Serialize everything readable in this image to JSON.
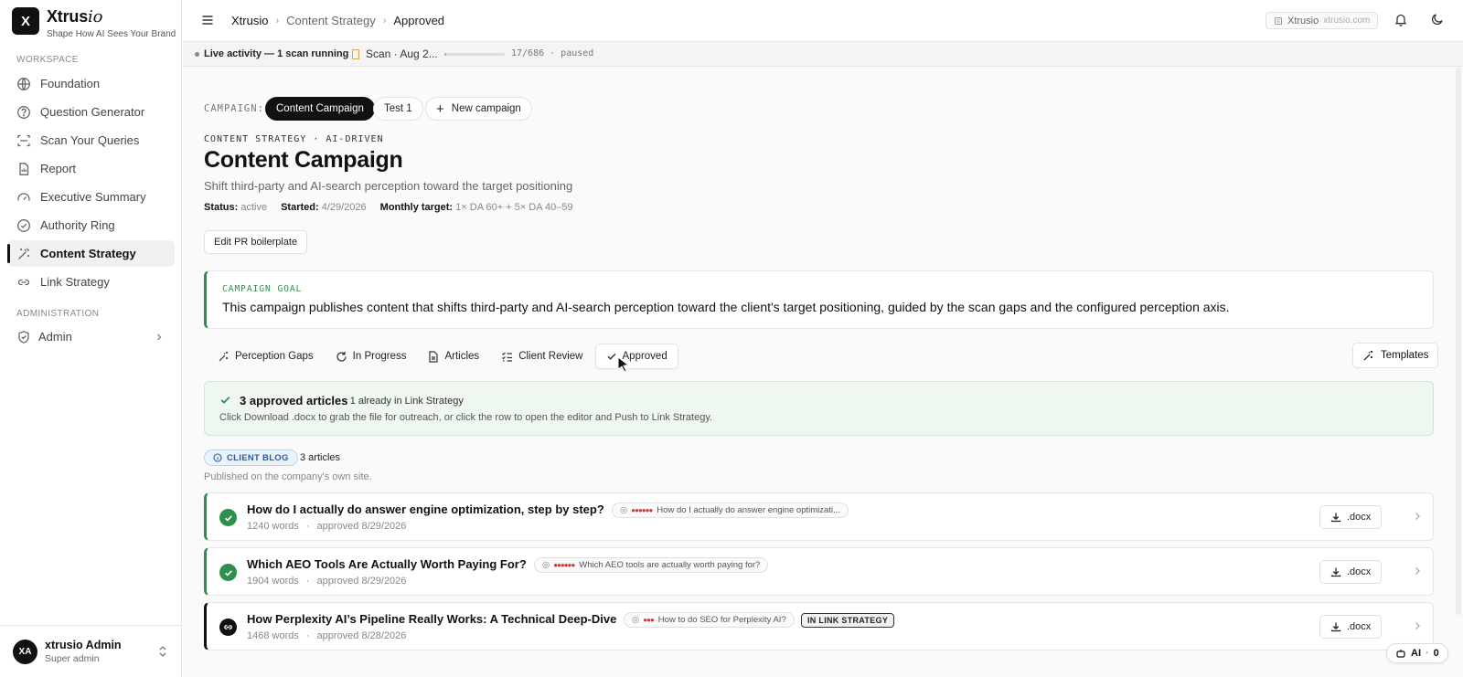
{
  "brand": {
    "logo_letter": "X",
    "name_main": "Xtrus",
    "name_italic": "io",
    "tagline": "Shape How AI Sees Your Brand"
  },
  "sidebar": {
    "workspace_label": "WORKSPACE",
    "admin_label": "ADMINISTRATION",
    "items": [
      {
        "label": "Foundation",
        "icon": "globe-icon"
      },
      {
        "label": "Question Generator",
        "icon": "question-circle-icon"
      },
      {
        "label": "Scan Your Queries",
        "icon": "scan-icon"
      },
      {
        "label": "Report",
        "icon": "report-icon"
      },
      {
        "label": "Executive Summary",
        "icon": "gauge-icon"
      },
      {
        "label": "Authority Ring",
        "icon": "check-circle-icon"
      },
      {
        "label": "Content Strategy",
        "icon": "magic-wand-icon",
        "active": true
      },
      {
        "label": "Link Strategy",
        "icon": "link-icon"
      }
    ],
    "admin_item": {
      "label": "Admin",
      "icon": "shield-icon"
    }
  },
  "user": {
    "initials": "XA",
    "name": "xtrusio Admin",
    "role": "Super admin"
  },
  "topbar": {
    "breadcrumbs": [
      "Xtrusio",
      "Content Strategy",
      "Approved"
    ],
    "workspace_name": "Xtrusio",
    "workspace_domain": "xtrusio.com"
  },
  "activity": {
    "label": "Live activity — 1 scan running",
    "scan_label": "Scan · Aug 2...",
    "scan_done": 17,
    "scan_total": 686,
    "scan_count_text": "17/686 · paused"
  },
  "campaign": {
    "label": "CAMPAIGN:",
    "pills": [
      "Content Campaign",
      "Test 1"
    ],
    "new_label": "New campaign",
    "eyebrow": "CONTENT STRATEGY · AI-DRIVEN",
    "title": "Content Campaign",
    "subtitle": "Shift third-party and AI-search perception toward the target positioning",
    "status_key": "Status:",
    "status_val": "active",
    "started_key": "Started:",
    "started_val": "4/29/2026",
    "target_key": "Monthly target:",
    "target_val": "1× DA 60+ + 5× DA 40–59",
    "edit_button": "Edit PR boilerplate"
  },
  "goal": {
    "label": "CAMPAIGN GOAL",
    "text": "This campaign publishes content that shifts third-party and AI-search perception toward the client's target positioning, guided by the scan gaps and the configured perception axis."
  },
  "tabs": [
    {
      "label": "Perception Gaps",
      "icon": "sparkle-icon"
    },
    {
      "label": "In Progress",
      "icon": "refresh-icon"
    },
    {
      "label": "Articles",
      "icon": "document-icon"
    },
    {
      "label": "Client Review",
      "icon": "checklist-icon"
    },
    {
      "label": "Approved",
      "icon": "check-icon",
      "active": true
    }
  ],
  "templates_label": "Templates",
  "approved_banner": {
    "title": "3 approved articles",
    "subtitle": "· 1 already in Link Strategy",
    "description": "Click Download .docx to grab the file for outreach, or click the row to open the editor and Push to Link Strategy."
  },
  "blog": {
    "chip": "CLIENT BLOG",
    "count": "3 articles",
    "description": "Published on the company's own site."
  },
  "articles": [
    {
      "title": "How do I actually do answer engine optimization, step by step?",
      "words": "1240 words",
      "approved": "approved 8/29/2026",
      "query": "How do I actually do answer engine optimizati...",
      "dots": "●●●●●●",
      "status": "approved"
    },
    {
      "title": "Which AEO Tools Are Actually Worth Paying For?",
      "words": "1904 words",
      "approved": "approved 8/29/2026",
      "query": "Which AEO tools are actually worth paying for?",
      "dots": "●●●●●●",
      "status": "approved"
    },
    {
      "title": "How Perplexity AI’s Pipeline Really Works: A Technical Deep-Dive",
      "words": "1468 words",
      "approved": "approved 8/28/2026",
      "query": "How to do SEO for Perplexity AI?",
      "dots": "●●●",
      "status": "in-link-strategy",
      "badge": "IN LINK STRATEGY"
    }
  ],
  "docx_label": ".docx",
  "ai_chip": {
    "label": "AI",
    "count": "0"
  },
  "colors": {
    "accent_green": "#2f8f4f",
    "blog_blue": "#2a5a9a",
    "query_dots_red": "#d13b3b"
  }
}
